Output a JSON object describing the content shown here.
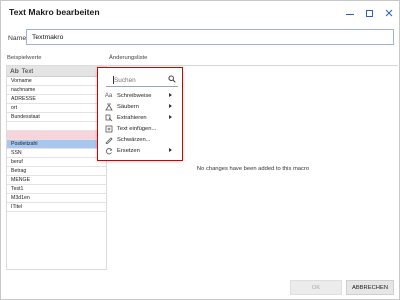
{
  "window": {
    "title": "Text Makro bearbeiten"
  },
  "name_field": {
    "label": "Name",
    "value": "Textmakro"
  },
  "beispielwerte": {
    "label": "Beispielwerte",
    "header": {
      "icon": "ab-text-icon",
      "icon_glyph": "Ab",
      "label": "Text"
    },
    "items": [
      "Vorname",
      "nachname",
      "ADRESSE",
      "ort",
      "Bundesstaat",
      "",
      "Postleitzahl",
      "SSN",
      "beruf",
      "Betrag",
      "MENGE",
      "Test1",
      "M3d1en",
      "ITitel"
    ],
    "selected_item": "Postleitzahl"
  },
  "aenderungsliste": {
    "label": "Änderungsliste",
    "empty_message": "No changes have been added to this macro"
  },
  "popup_menu": {
    "search_placeholder": "Suchen",
    "items": [
      {
        "label": "Schreibweise",
        "icon": "case-icon",
        "has_submenu": true
      },
      {
        "label": "Säubern",
        "icon": "clean-icon",
        "has_submenu": true
      },
      {
        "label": "Extrahieren",
        "icon": "extract-icon",
        "has_submenu": true
      },
      {
        "label": "Text einfügen...",
        "icon": "insert-text-icon",
        "has_submenu": false
      },
      {
        "label": "Schwärzen...",
        "icon": "redact-icon",
        "has_submenu": false
      },
      {
        "label": "Ersetzen",
        "icon": "replace-icon",
        "has_submenu": true
      }
    ]
  },
  "buttons": {
    "ok": "OK",
    "cancel": "ABBRECHEN"
  },
  "colors": {
    "accent": "#2b5fb8",
    "highlight_border": "#d40000",
    "selected_row": "#a9c7ee",
    "pink_row": "#f7d3dc"
  }
}
